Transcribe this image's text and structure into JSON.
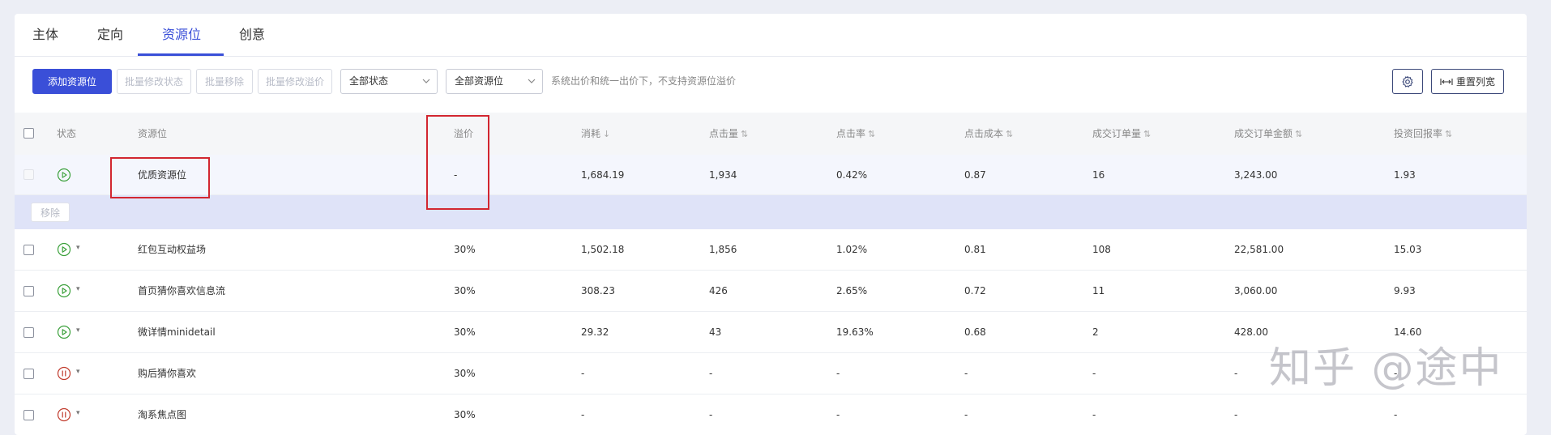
{
  "tabs": [
    {
      "label": "主体",
      "active": false
    },
    {
      "label": "定向",
      "active": false
    },
    {
      "label": "资源位",
      "active": true
    },
    {
      "label": "创意",
      "active": false
    }
  ],
  "toolbar": {
    "add_label": "添加资源位",
    "batch_status_label": "批量修改状态",
    "batch_remove_label": "批量移除",
    "batch_premium_label": "批量修改溢价",
    "status_select": "全部状态",
    "resource_select": "全部资源位",
    "hint": "系统出价和统一出价下，不支持资源位溢价",
    "settings_icon": "gear-icon",
    "reset_width_label": "重置列宽"
  },
  "columns": {
    "status": "状态",
    "resource": "资源位",
    "premium": "溢价",
    "cost": "消耗",
    "clicks": "点击量",
    "ctr": "点击率",
    "cpc": "点击成本",
    "orders": "成交订单量",
    "order_amount": "成交订单金额",
    "roi": "投资回报率"
  },
  "sort_marks": {
    "cost": "↓",
    "clicks": "⇅",
    "ctr": "⇅",
    "cpc": "⇅",
    "orders": "⇅",
    "order_amount": "⇅",
    "roi": "⇅"
  },
  "selected_row": {
    "status": "running",
    "name": "优质资源位",
    "premium": "-",
    "cost": "1,684.19",
    "clicks": "1,934",
    "ctr": "0.42%",
    "cpc": "0.87",
    "orders": "16",
    "order_amount": "3,243.00",
    "roi": "1.93"
  },
  "remove_label": "移除",
  "rows": [
    {
      "status": "running",
      "name": "红包互动权益场",
      "premium": "30%",
      "cost": "1,502.18",
      "clicks": "1,856",
      "ctr": "1.02%",
      "cpc": "0.81",
      "orders": "108",
      "order_amount": "22,581.00",
      "roi": "15.03"
    },
    {
      "status": "running",
      "name": "首页猜你喜欢信息流",
      "premium": "30%",
      "cost": "308.23",
      "clicks": "426",
      "ctr": "2.65%",
      "cpc": "0.72",
      "orders": "11",
      "order_amount": "3,060.00",
      "roi": "9.93"
    },
    {
      "status": "running",
      "name": "微详情minidetail",
      "premium": "30%",
      "cost": "29.32",
      "clicks": "43",
      "ctr": "19.63%",
      "cpc": "0.68",
      "orders": "2",
      "order_amount": "428.00",
      "roi": "14.60"
    },
    {
      "status": "paused",
      "name": "购后猜你喜欢",
      "premium": "30%",
      "cost": "-",
      "clicks": "-",
      "ctr": "-",
      "cpc": "-",
      "orders": "-",
      "order_amount": "-",
      "roi": "-"
    },
    {
      "status": "paused",
      "name": "淘系焦点图",
      "premium": "30%",
      "cost": "-",
      "clicks": "-",
      "ctr": "-",
      "cpc": "-",
      "orders": "-",
      "order_amount": "-",
      "roi": "-"
    }
  ],
  "watermark": "知乎 @途中",
  "colors": {
    "accent": "#3a4fd8",
    "running": "#3aa03a",
    "paused": "#c0392b",
    "highlight": "#d22630"
  }
}
